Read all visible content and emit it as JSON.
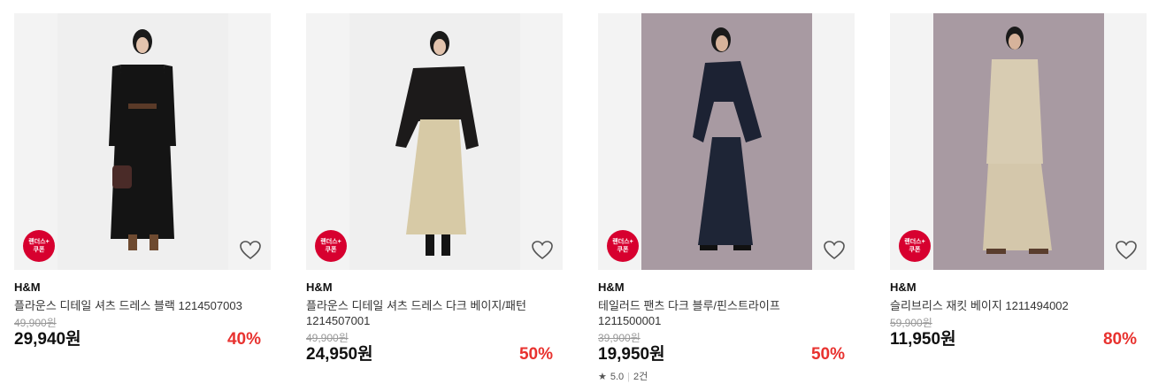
{
  "products": [
    {
      "brand": "H&M",
      "name": "플라운스 디테일 셔츠 드레스 블랙 1214507003",
      "original_price": "49,900원",
      "price": "29,940원",
      "discount": "40%",
      "badge_line1": "랜더스+",
      "badge_line2": "쿠폰",
      "photo_bg": "#efefef"
    },
    {
      "brand": "H&M",
      "name": "플라운스 디테일 셔츠 드레스 다크 베이지/패턴 1214507001",
      "original_price": "49,900원",
      "price": "24,950원",
      "discount": "50%",
      "badge_line1": "랜더스+",
      "badge_line2": "쿠폰",
      "photo_bg": "#efefef"
    },
    {
      "brand": "H&M",
      "name": "테일러드 팬츠 다크 블루/핀스트라이프 1211500001",
      "original_price": "39,900원",
      "price": "19,950원",
      "discount": "50%",
      "badge_line1": "랜더스+",
      "badge_line2": "쿠폰",
      "rating": "5.0",
      "review_count": "2건",
      "photo_bg": "#a89aa2"
    },
    {
      "brand": "H&M",
      "name": "슬리브리스 재킷 베이지 1211494002",
      "original_price": "59,900원",
      "price": "11,950원",
      "discount": "80%",
      "badge_line1": "랜더스+",
      "badge_line2": "쿠폰",
      "photo_bg": "#a89aa2"
    }
  ],
  "colors": {
    "discount": "#e8322f",
    "badge": "#d7002f"
  },
  "icons": {
    "wishlist": "heart-outline-icon",
    "rating": "star-icon"
  }
}
